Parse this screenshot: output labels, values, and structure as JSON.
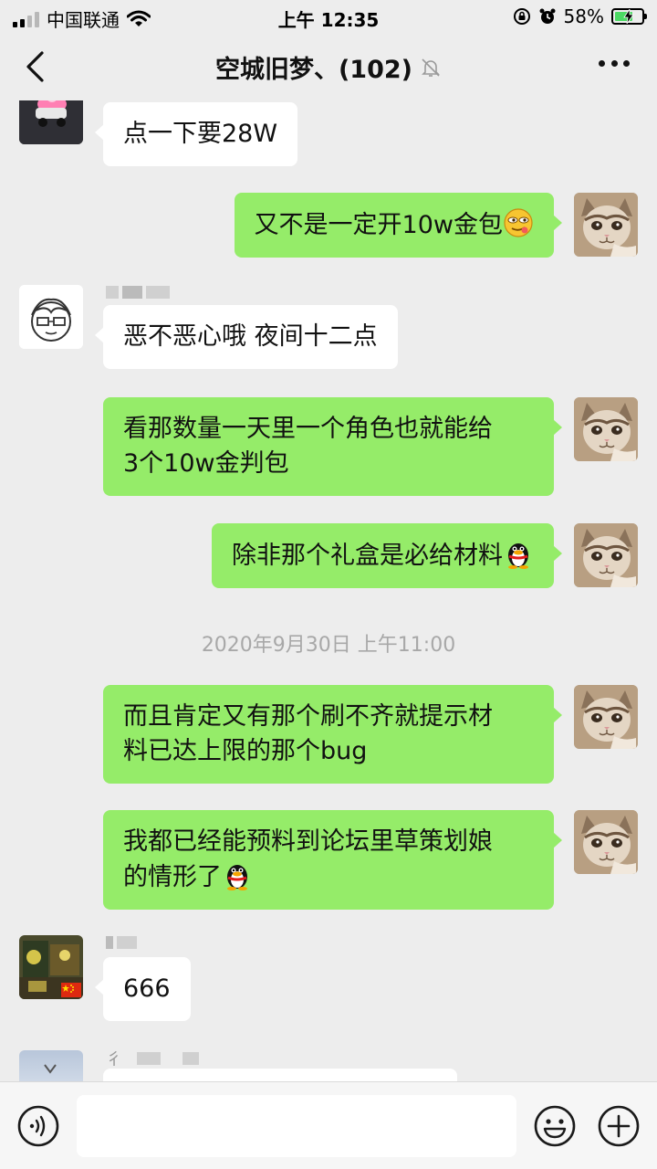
{
  "status_bar": {
    "carrier": "中国联通",
    "time": "上午 12:35",
    "battery_percent": "58%",
    "battery_level": 0.58,
    "icons": [
      "signal-icon",
      "wifi-icon",
      "orientation-lock-icon",
      "alarm-icon",
      "battery-charging-icon"
    ]
  },
  "nav": {
    "title": "空城旧梦、(102)",
    "icons": [
      "back-icon",
      "mute-bell-icon",
      "more-icon"
    ]
  },
  "messages": [
    {
      "dir": "in",
      "text": "点一下要28W",
      "avatar": "cartoon-avatar"
    },
    {
      "dir": "out",
      "text": "又不是一定开10w金包",
      "emoji": "smirk-emoji"
    },
    {
      "dir": "in",
      "text": "恶不恶心哦 夜间十二点",
      "avatar": "sketch-face-avatar"
    },
    {
      "dir": "out",
      "lines": [
        "看那数量一天里一个角色也就能给",
        "3个10w金判包"
      ]
    },
    {
      "dir": "out",
      "text": "除非那个礼盒是必给材料",
      "emoji": "qq-penguin-emoji"
    },
    {
      "type": "time",
      "text": "2020年9月30日 上午11:00"
    },
    {
      "dir": "out",
      "lines": [
        "而且肯定又有那个刷不齐就提示材",
        "料已达上限的那个bug"
      ]
    },
    {
      "dir": "out",
      "lines": [
        "我都已经能预料到论坛里草策划娘",
        "的情形了"
      ],
      "emoji": "qq-penguin-emoji"
    },
    {
      "dir": "in",
      "text": "666",
      "avatar": "photo-avatar",
      "badge": "china-flag-icon"
    },
    {
      "dir": "in",
      "text": "",
      "avatar": "sky-avatar",
      "partial": true,
      "nick_fragment": "彳"
    }
  ],
  "colors": {
    "background": "#ededed",
    "outgoing_bubble": "#95ec69",
    "incoming_bubble": "#ffffff",
    "timestamp": "#a8a8a8",
    "battery_fill": "#4cd964"
  },
  "input_bar": {
    "value": "",
    "icons": [
      "voice-icon",
      "emoji-icon",
      "plus-icon"
    ]
  }
}
